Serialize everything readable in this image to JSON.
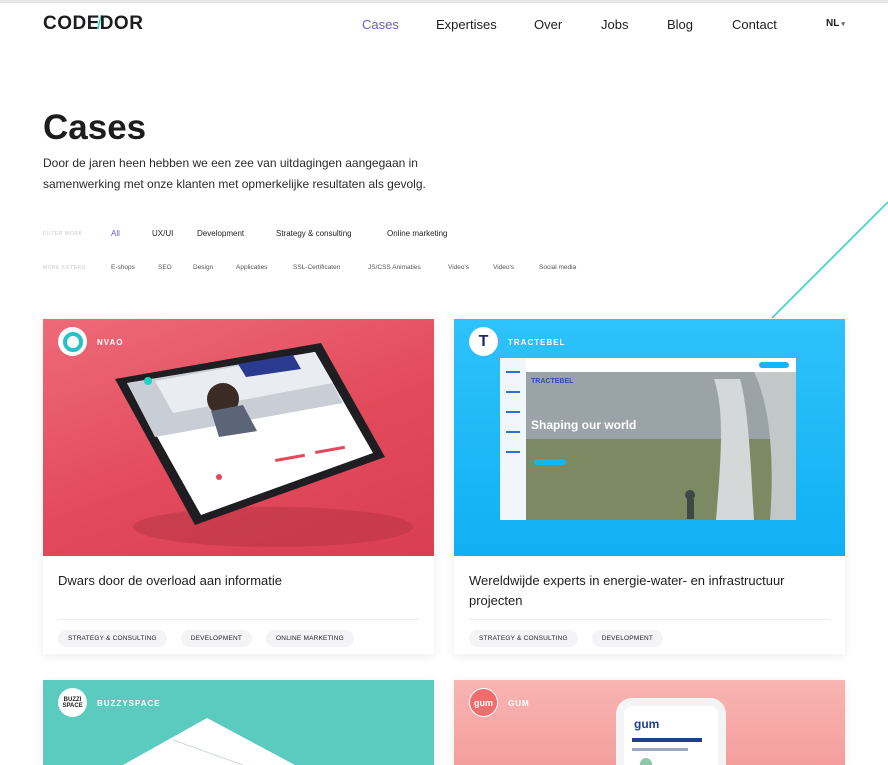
{
  "header": {
    "logo_left": "CODE",
    "logo_slash": "/",
    "logo_right": "DOR",
    "nav": [
      {
        "label": "Cases",
        "active": true
      },
      {
        "label": "Expertises",
        "active": false
      },
      {
        "label": "Over",
        "active": false
      },
      {
        "label": "Jobs",
        "active": false
      },
      {
        "label": "Blog",
        "active": false
      },
      {
        "label": "Contact",
        "active": false
      }
    ],
    "lang": "NL",
    "lang_caret": "▾"
  },
  "page": {
    "title": "Cases",
    "intro": "Door de jaren heen hebben we een zee van uitdagingen aangegaan in samenwerking met onze klanten met opmerkelijke resultaten als gevolg."
  },
  "filters": {
    "work_label": "FILTER WORK",
    "work": [
      "All",
      "UX/UI",
      "Development",
      "Strategy & consulting",
      "Online marketing"
    ],
    "more_label": "MORE FILTERS",
    "more": [
      "E-shops",
      "SEO",
      "Design",
      "Applicaties",
      "SSL-Certificaten",
      "JS/CSS Animaties",
      "Video's",
      "Video's",
      "Social media"
    ]
  },
  "cards": [
    {
      "client": "NVAO",
      "title": "Dwars door de overload aan informatie",
      "tags": [
        "STRATEGY & CONSULTING",
        "DEVELOPMENT",
        "ONLINE MARKETING"
      ],
      "bg": "#e74f60"
    },
    {
      "client": "TRACTEBEL",
      "badge_letter": "T",
      "title": "Wereldwijde experts in energie-water- en infrastructuur projecten",
      "tags": [
        "STRATEGY & CONSULTING",
        "DEVELOPMENT"
      ],
      "bg": "#12b6f5",
      "screen_heading": "Shaping our world",
      "screen_brand": "TRACTEBEL"
    },
    {
      "client": "BUZZYSPACE",
      "badge_text": "BUZZI SPACE",
      "bg": "#5ccbbf"
    },
    {
      "client": "GUM",
      "badge_text": "gum",
      "bg": "#f6a6a6"
    }
  ],
  "colors": {
    "accent": "#6a5ad8",
    "teal": "#1bd6c3"
  }
}
